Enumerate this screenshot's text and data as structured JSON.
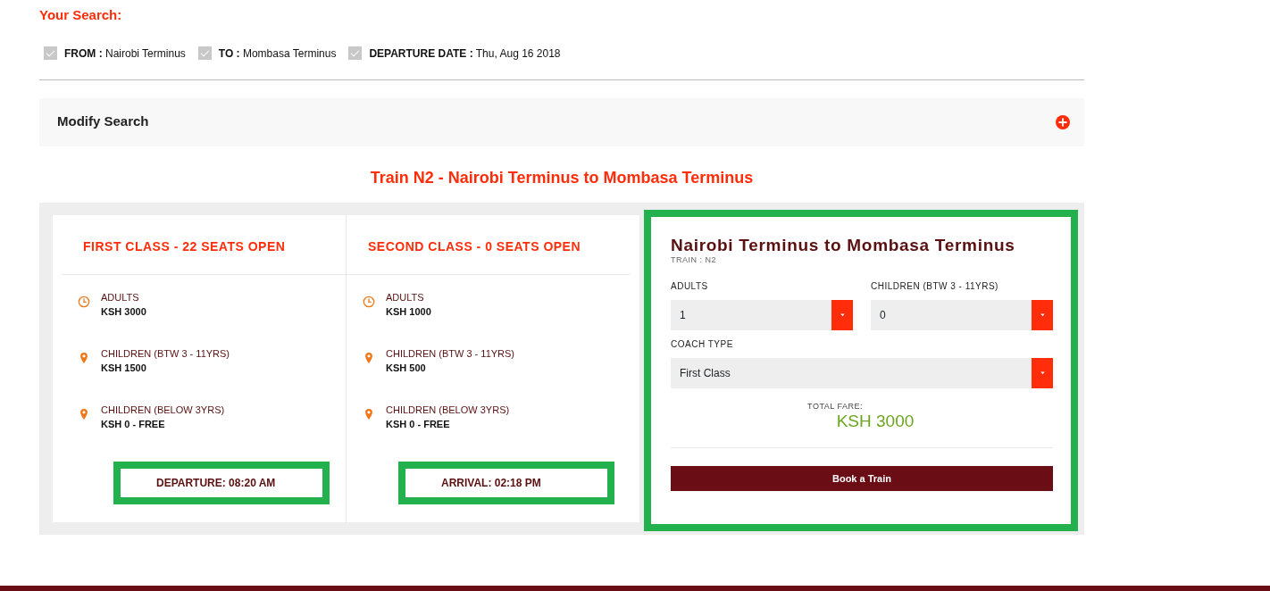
{
  "search_heading": "Your Search:",
  "criteria": [
    {
      "label": "FROM :",
      "value": "Nairobi Terminus",
      "checked": true
    },
    {
      "label": "TO :",
      "value": "Mombasa Terminus",
      "checked": true
    },
    {
      "label": "DEPARTURE DATE :",
      "value": "Thu, Aug 16 2018",
      "checked": true
    }
  ],
  "modify_search": {
    "label": "Modify Search",
    "expanded": false
  },
  "train_title": "Train N2 - Nairobi Terminus to Mombasa Terminus",
  "classes": [
    {
      "heading": "FIRST CLASS - 22 SEATS OPEN",
      "fares": [
        {
          "kind": "clock",
          "label": "ADULTS",
          "price": "KSH 3000"
        },
        {
          "kind": "pin",
          "label": "CHILDREN (BTW 3 - 11YRS)",
          "price": "KSH 1500"
        },
        {
          "kind": "pin",
          "label": "CHILDREN (BELOW 3YRS)",
          "price": "KSH 0 - FREE"
        }
      ],
      "time": "DEPARTURE: 08:20 AM",
      "highlighted": true
    },
    {
      "heading": "SECOND CLASS - 0 SEATS OPEN",
      "fares": [
        {
          "kind": "clock",
          "label": "ADULTS",
          "price": "KSH 1000"
        },
        {
          "kind": "pin",
          "label": "CHILDREN (BTW 3 - 11YRS)",
          "price": "KSH 500"
        },
        {
          "kind": "pin",
          "label": "CHILDREN (BELOW 3YRS)",
          "price": "KSH 0 - FREE"
        }
      ],
      "time": "ARRIVAL: 02:18 PM",
      "highlighted": true
    }
  ],
  "booking": {
    "title": "Nairobi Terminus to Mombasa Terminus",
    "subtitle": "TRAIN : N2",
    "highlighted": true,
    "fields": [
      {
        "label": "ADULTS",
        "value": "1",
        "wide": false
      },
      {
        "label": "CHILDREN (BTW 3 - 11YRS)",
        "value": "0",
        "wide": false
      },
      {
        "label": "COACH TYPE",
        "value": "First Class",
        "wide": true
      }
    ],
    "total_label": "TOTAL FARE:",
    "total_value": "KSH 3000",
    "button": "Book a Train"
  }
}
